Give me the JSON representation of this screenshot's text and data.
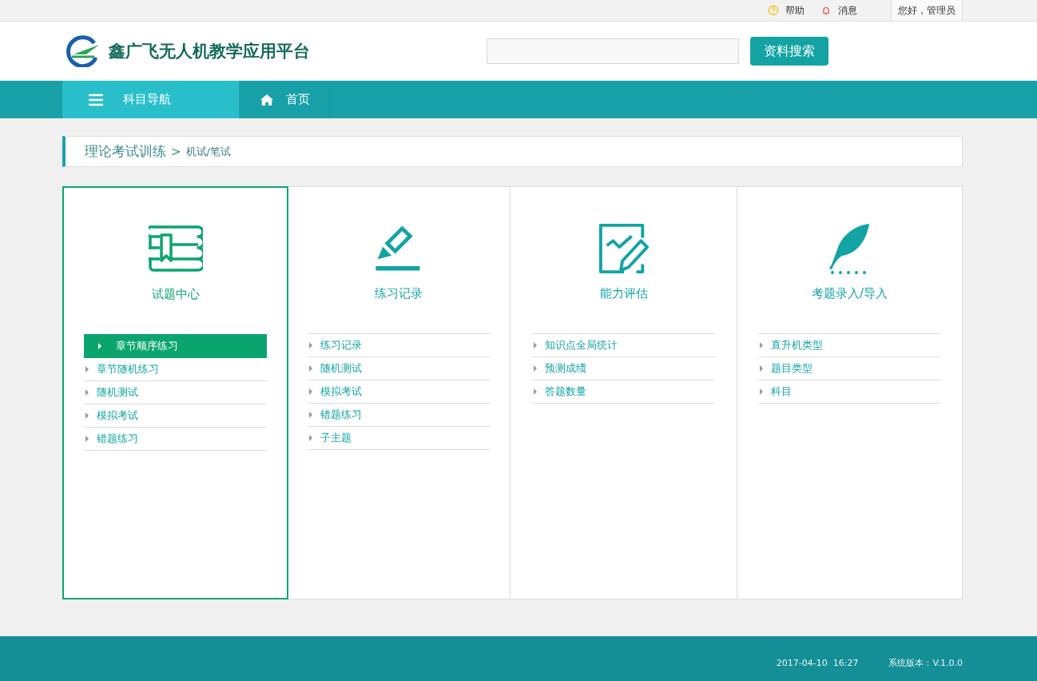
{
  "top_bar": {
    "help": "帮助",
    "messages": "消息",
    "greeting": "您好，管理员"
  },
  "header": {
    "logo_text": "鑫广飞无人机教学应用平台",
    "search_button": "资料搜索"
  },
  "nav": [
    {
      "label": "科目导航",
      "kind": "menu",
      "selected": true
    },
    {
      "label": "首页",
      "kind": "home",
      "selected": false
    }
  ],
  "breadcrumb": {
    "section": "理论考试训练",
    "separator": ">",
    "current": "机试/笔试"
  },
  "panels": [
    {
      "title": "试题中心",
      "kind": "book",
      "selected": true,
      "items": [
        {
          "label": "章节顺序练习",
          "selected": true
        },
        {
          "label": "章节随机练习",
          "selected": false
        },
        {
          "label": "随机测试",
          "selected": false
        },
        {
          "label": "模拟考试",
          "selected": false
        },
        {
          "label": "错题练习",
          "selected": false
        }
      ]
    },
    {
      "title": "练习记录",
      "kind": "pen",
      "selected": false,
      "items": [
        {
          "label": "练习记录",
          "selected": false
        },
        {
          "label": "随机测试",
          "selected": false
        },
        {
          "label": "模拟考试",
          "selected": false
        },
        {
          "label": "错题练习",
          "selected": false
        },
        {
          "label": "子主题",
          "selected": false
        }
      ]
    },
    {
      "title": "能力评估",
      "kind": "chart",
      "selected": false,
      "items": [
        {
          "label": "知识点全局统计",
          "selected": false
        },
        {
          "label": "预测成绩",
          "selected": false
        },
        {
          "label": "答题数量",
          "selected": false
        }
      ]
    },
    {
      "title": "考题录入/导入",
      "kind": "feather",
      "selected": false,
      "items": [
        {
          "label": "直升机类型",
          "selected": false
        },
        {
          "label": "题目类型",
          "selected": false
        },
        {
          "label": "科目",
          "selected": false
        }
      ]
    }
  ],
  "footer": {
    "datetime": "2017-04-10  16:27",
    "version": "系统版本：V.1.0.0"
  }
}
